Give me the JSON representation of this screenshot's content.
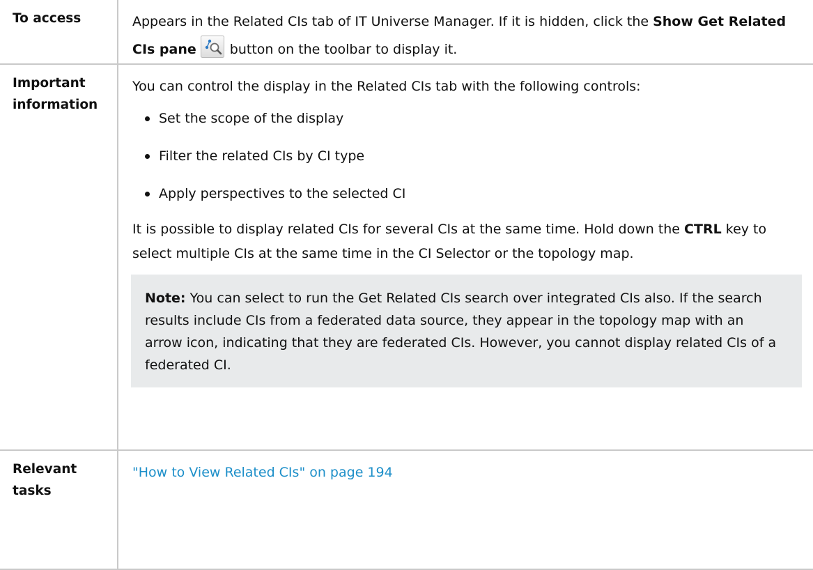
{
  "rows": {
    "access": {
      "label": "To access",
      "text_before": "Appears in the Related CIs tab of IT Universe Manager. If it is hidden, click the ",
      "bold_label": "Show Get Related CIs pane",
      "icon": "get-related-cis-icon",
      "text_after": "button on the toolbar to display it."
    },
    "important": {
      "label": "Important information",
      "intro": "You can control the display in the Related CIs tab with the following controls:",
      "bullets": [
        "Set the scope of the display",
        "Filter the related CIs by CI type",
        "Apply perspectives to the selected CI"
      ],
      "para_before": "It is possible to display related CIs for several CIs at the same time. Hold down the ",
      "para_bold": "CTRL",
      "para_after": " key to select multiple CIs at the same time in the CI Selector or the topology map.",
      "note_label": "Note:",
      "note_text": "You can select to run the Get Related CIs search over integrated CIs also. If the search results include CIs from a federated data source, they appear in the topology map with an arrow icon, indicating that they are federated CIs. However, you cannot display related CIs of a federated CI."
    },
    "tasks": {
      "label": "Relevant tasks",
      "link_text": "\"How to View Related CIs\" on page 194"
    }
  },
  "colors": {
    "border": "#c9c9c9",
    "note_background": "#e8eaeb",
    "link": "#1d8fc9",
    "icon_blue": "#2a79c4"
  }
}
